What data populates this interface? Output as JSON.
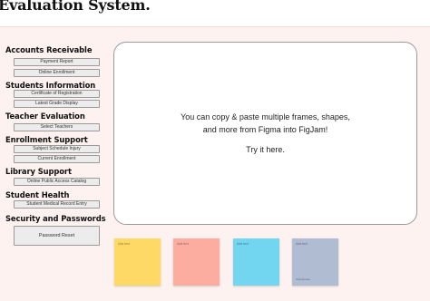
{
  "app": {
    "title": "Evaluation System."
  },
  "sidebar": {
    "sections": [
      {
        "heading": "Accounts Receivable",
        "items": [
          "Payment Report",
          "Online Enrollment"
        ]
      },
      {
        "heading": "Students Information",
        "items": [
          "Certificate of Registration",
          "Latest Grade Display"
        ]
      },
      {
        "heading": "Teacher Evaluation",
        "items": [
          "Select Teachers"
        ]
      },
      {
        "heading": "Enrollment Support",
        "items": [
          "Subject Schedule Injury",
          "Current Enrollment"
        ]
      },
      {
        "heading": "Library Support",
        "items": [
          "Online Public Access Catalog"
        ]
      },
      {
        "heading": "Student Health",
        "items": [
          "Student Medical Record Entry"
        ]
      },
      {
        "heading": "Security and Passwords",
        "items": [
          "Password Reset"
        ]
      }
    ]
  },
  "frame": {
    "message_line1": "You can copy & paste multiple frames, shapes,",
    "message_line2": "and more from Figma into FigJam!",
    "cta": "Try it here."
  },
  "stickies": [
    {
      "label": "Add text",
      "color": "#ffd966",
      "sub": ""
    },
    {
      "label": "Add text",
      "color": "#fdaca0",
      "sub": ""
    },
    {
      "label": "Add text",
      "color": "#72d6f0",
      "sub": ""
    },
    {
      "label": "Add text",
      "color": "#b0bcd2",
      "sub": "Anonymous"
    }
  ],
  "colors": {
    "canvas": "#fdf2f0",
    "button_fill": "#ececec",
    "button_border": "#9a9a9a"
  }
}
